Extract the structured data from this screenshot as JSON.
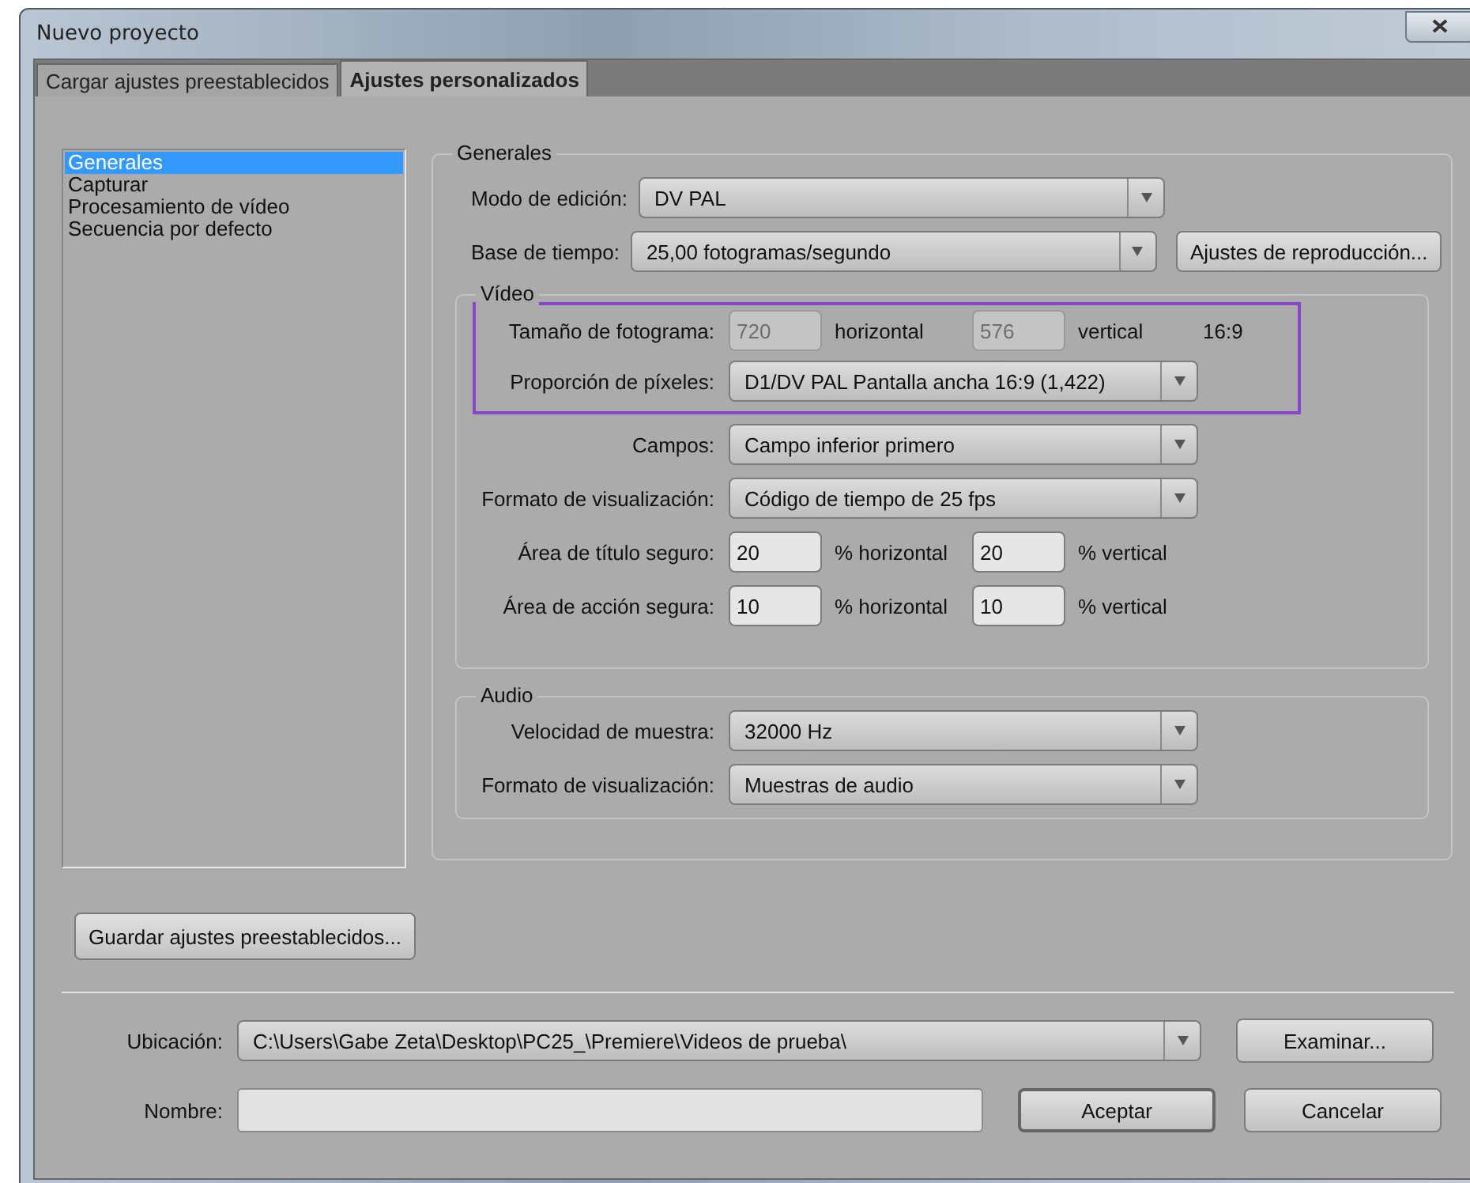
{
  "window": {
    "title": "Nuevo proyecto"
  },
  "tabs": [
    {
      "label": "Cargar ajustes preestablecidos",
      "selected": false
    },
    {
      "label": "Ajustes personalizados",
      "selected": true
    }
  ],
  "sidebar": {
    "items": [
      {
        "label": "Generales",
        "selected": true
      },
      {
        "label": "Capturar",
        "selected": false
      },
      {
        "label": "Procesamiento de vídeo",
        "selected": false
      },
      {
        "label": "Secuencia por defecto",
        "selected": false
      }
    ]
  },
  "generales": {
    "title": "Generales",
    "rows": [
      {
        "label": "Modo de edición:",
        "value": "DV PAL"
      },
      {
        "label": "Base de tiempo:",
        "value": "25,00 fotogramas/segundo",
        "button": "Ajustes de reproducción..."
      }
    ],
    "video": {
      "title": "Vídeo",
      "rows": [
        {
          "kind": "fields",
          "highlighted": true,
          "label": "Tamaño de fotograma:",
          "fields": [
            {
              "value": "720",
              "unit": "horizontal",
              "disabled": true
            },
            {
              "value": "576",
              "unit": "vertical",
              "disabled": true
            }
          ],
          "note": "16:9"
        },
        {
          "kind": "dropdown",
          "highlighted": true,
          "label": "Proporción de píxeles:",
          "value": "D1/DV PAL Pantalla ancha 16:9 (1,422)"
        },
        {
          "kind": "dropdown",
          "highlighted": false,
          "label": "Campos:",
          "value": "Campo inferior primero"
        },
        {
          "kind": "dropdown",
          "highlighted": false,
          "label": "Formato de visualización:",
          "value": "Código de tiempo de 25 fps"
        },
        {
          "kind": "fields",
          "highlighted": false,
          "label": "Área de título seguro:",
          "fields": [
            {
              "value": "20",
              "unit": "% horizontal",
              "disabled": false
            },
            {
              "value": "20",
              "unit": "% vertical",
              "disabled": false
            }
          ]
        },
        {
          "kind": "fields",
          "highlighted": false,
          "label": "Área de acción segura:",
          "fields": [
            {
              "value": "10",
              "unit": "% horizontal",
              "disabled": false
            },
            {
              "value": "10",
              "unit": "% vertical",
              "disabled": false
            }
          ]
        }
      ]
    },
    "audio": {
      "title": "Audio",
      "rows": [
        {
          "kind": "dropdown",
          "highlighted": false,
          "label": "Velocidad de muestra:",
          "value": "32000 Hz"
        },
        {
          "kind": "dropdown",
          "highlighted": false,
          "label": "Formato de visualización:",
          "value": "Muestras de audio"
        }
      ]
    }
  },
  "save_button": "Guardar ajustes preestablecidos...",
  "location": {
    "label": "Ubicación:",
    "value": "C:\\Users\\Gabe Zeta\\Desktop\\PC25_\\Premiere\\Videos de prueba\\",
    "button": "Examinar..."
  },
  "name": {
    "label": "Nombre:"
  },
  "buttons": [
    {
      "label": "Aceptar",
      "default": true
    },
    {
      "label": "Cancelar",
      "default": false
    }
  ]
}
